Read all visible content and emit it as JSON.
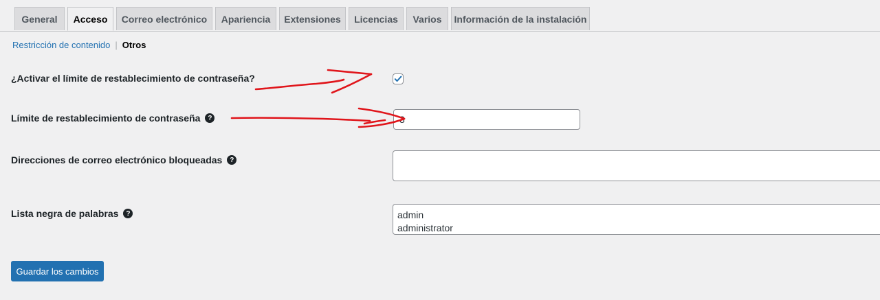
{
  "tabs": [
    {
      "label": "General",
      "active": false
    },
    {
      "label": "Acceso",
      "active": true
    },
    {
      "label": "Correo electrónico",
      "active": false
    },
    {
      "label": "Apariencia",
      "active": false
    },
    {
      "label": "Extensiones",
      "active": false
    },
    {
      "label": "Licencias",
      "active": false
    },
    {
      "label": "Varios",
      "active": false
    },
    {
      "label": "Información de la instalación",
      "active": false
    }
  ],
  "subnav": {
    "link": "Restricción de contenido",
    "separator": "|",
    "current": "Otros"
  },
  "fields": {
    "reset_limit_enable": {
      "label": "¿Activar el límite de restablecimiento de contraseña?",
      "checked": true
    },
    "reset_limit": {
      "label": "Límite de restablecimiento de contraseña",
      "value": "3"
    },
    "blocked_emails": {
      "label": "Direcciones de correo electrónico bloqueadas",
      "value": ""
    },
    "word_blacklist": {
      "label": "Lista negra de palabras",
      "lines": [
        "admin",
        "administrator"
      ]
    }
  },
  "save_button": "Guardar los cambios",
  "help_icon_glyph": "?",
  "icons": [
    "help-icon",
    "checkmark-icon"
  ],
  "colors": {
    "primary": "#2271b1",
    "annotation": "#e0151b",
    "background": "#f0f0f1"
  }
}
